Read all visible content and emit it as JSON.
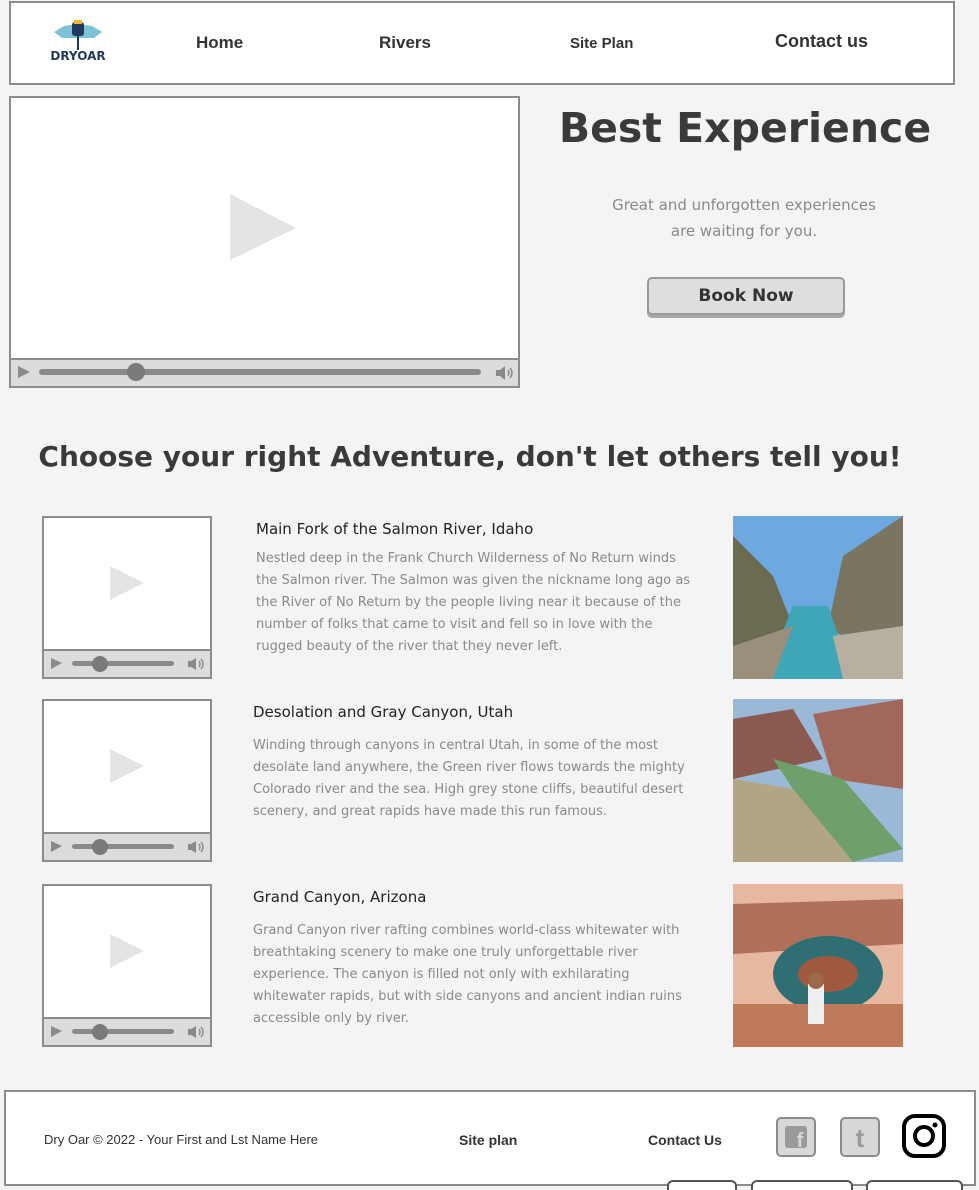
{
  "header": {
    "logo_text": "DRYOAR",
    "nav": [
      "Home",
      "Rivers",
      "Site Plan",
      "Contact us"
    ]
  },
  "hero": {
    "title": "Best Experience",
    "subtitle_line1": "Great and unforgotten experiences",
    "subtitle_line2": "are waiting for you.",
    "button": "Book Now"
  },
  "main_video": {
    "progress": 0.22
  },
  "section_title": "Choose your right Adventure, don't let others tell you!",
  "rivers": [
    {
      "title": "Main Fork of the Salmon River, Idaho",
      "description": "Nestled deep in the Frank Church Wilderness of No Return winds the Salmon river. The Salmon was given the nickname long ago as the River of No Return by the people living near it because of the number of folks that came to visit and fell so in love with the rugged beauty of the river that they never left."
    },
    {
      "title": "Desolation and Gray Canyon, Utah",
      "description": "Winding through canyons in central Utah, in some of the most desolate land anywhere, the Green river flows towards the mighty Colorado river and the sea. High grey stone cliffs, beautiful desert scenery, and great rapids have made this run famous."
    },
    {
      "title": "Grand Canyon, Arizona",
      "description": "Grand Canyon river rafting combines world-class whitewater with breathtaking scenery to make one truly unforgettable river experience. The canyon is filled not only with exhilarating whitewater rapids, but with side canyons and ancient indian ruins accessible only by river."
    }
  ],
  "footer": {
    "copyright": "Dry Oar © 2022 - Your First and Lst Name Here",
    "site_plan": "Site plan",
    "contact": "Contact Us",
    "social": [
      "facebook-icon",
      "twitter-icon",
      "instagram-icon"
    ]
  },
  "colors": {
    "border": "#8c8c8c",
    "panel": "#dcdcdc",
    "text_muted": "#8a8a8a"
  }
}
